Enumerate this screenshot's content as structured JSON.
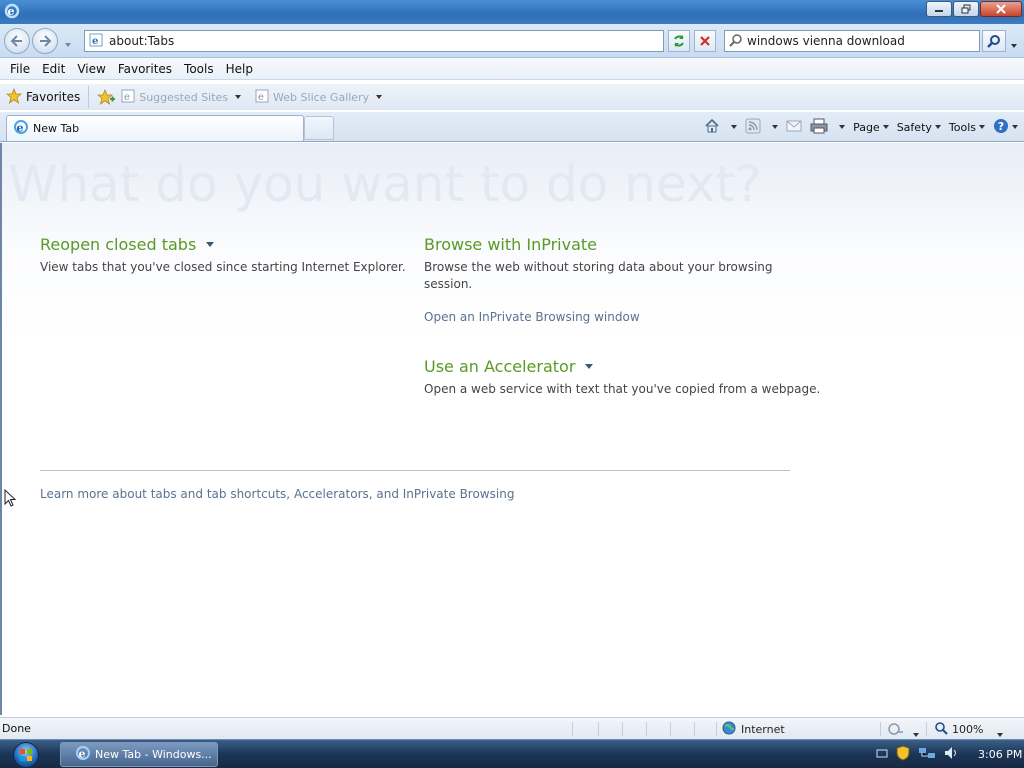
{
  "window": {
    "title": ""
  },
  "address": {
    "url": "about:Tabs"
  },
  "search": {
    "query": "windows vienna download"
  },
  "menu": {
    "items": [
      "File",
      "Edit",
      "View",
      "Favorites",
      "Tools",
      "Help"
    ]
  },
  "favorites_bar": {
    "favorites_label": "Favorites",
    "suggested_sites": "Suggested Sites",
    "web_slice_gallery": "Web Slice Gallery"
  },
  "tab": {
    "label": "New Tab"
  },
  "command_bar": {
    "page": "Page",
    "safety": "Safety",
    "tools": "Tools"
  },
  "content": {
    "headline": "What do you want to do next?",
    "reopen_title": "Reopen closed tabs",
    "reopen_desc": "View tabs that you've closed since starting Internet Explorer.",
    "inprivate_title": "Browse with InPrivate",
    "inprivate_desc": "Browse the web without storing data about your browsing session.",
    "inprivate_link": "Open an InPrivate Browsing window",
    "accelerator_title": "Use an Accelerator",
    "accelerator_desc": "Open a web service with text that you've copied from a webpage.",
    "learn_more": "Learn more about tabs and tab shortcuts, Accelerators, and InPrivate Browsing"
  },
  "status": {
    "text": "Done",
    "zone": "Internet",
    "zoom": "100%"
  },
  "taskbar": {
    "task_label": "New Tab - Windows...",
    "clock": "3:06 PM"
  },
  "colors": {
    "section_green": "#5a9a24",
    "link_blue": "#5a7390",
    "headline_faded": "#e2e9f2"
  }
}
